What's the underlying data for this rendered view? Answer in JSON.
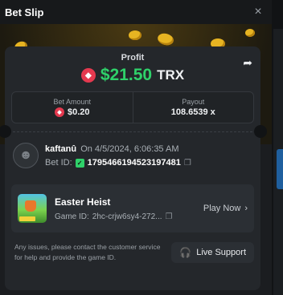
{
  "header": {
    "title": "Bet Slip",
    "close_icon": "×"
  },
  "profit": {
    "label": "Profit",
    "amount": "$21.50",
    "currency": "TRX",
    "share_icon": "➦",
    "token_glyph": "◆"
  },
  "stats": {
    "bet_amount_label": "Bet Amount",
    "bet_amount_value": "$0.20",
    "payout_label": "Payout",
    "payout_value": "108.6539 x"
  },
  "user": {
    "name": "kaftanû",
    "date": "On 4/5/2024, 6:06:35 AM",
    "bet_id_label": "Bet ID:",
    "bet_id": "1795466194523197481",
    "avatar_glyph": "☻",
    "shield_glyph": "✓",
    "copy_glyph": "❐"
  },
  "game": {
    "title": "Easter Heist",
    "game_id_label": "Game ID:",
    "game_id": "2hc-crjw6sy4-272...",
    "play_now": "Play Now",
    "chevron": "›"
  },
  "footer": {
    "note": "Any issues, please contact the customer service for help and provide the game ID.",
    "support_label": "Live Support",
    "headset_glyph": "🎧"
  },
  "colors": {
    "accent_green": "#2fd16a",
    "trx_red": "#e5394f",
    "card_bg": "#24272b",
    "modal_bg": "#1b1d20"
  }
}
